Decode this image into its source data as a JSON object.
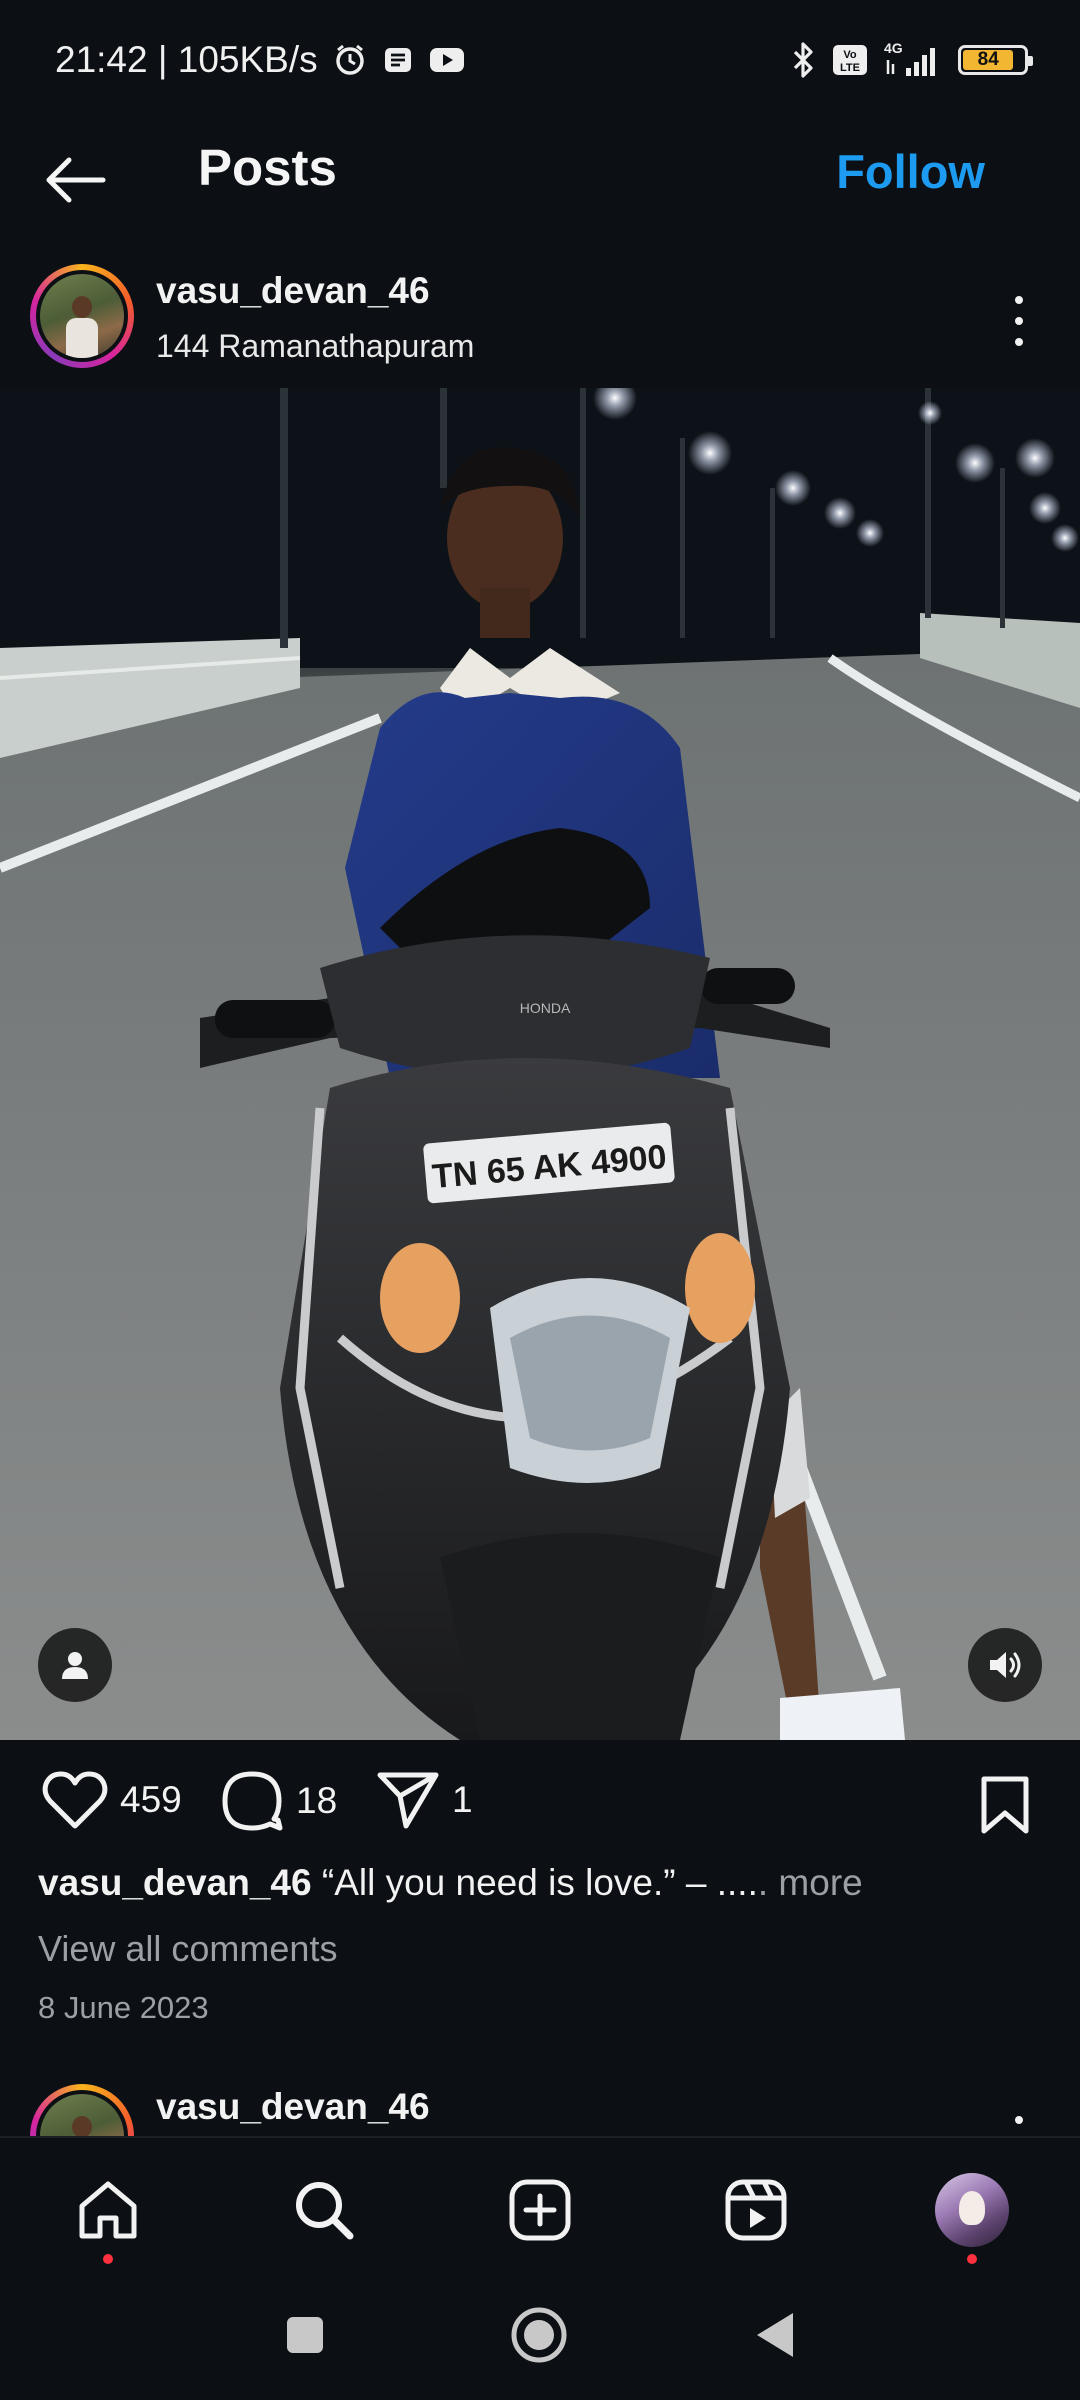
{
  "status_bar": {
    "time_speed": "21:42 | 105KB/s",
    "network": "4G",
    "volte": "Vo LTE",
    "battery": "84",
    "battery_level_percent": 84,
    "icons": [
      "alarm-icon",
      "notes-icon",
      "youtube-icon",
      "bluetooth-icon",
      "signal-icon"
    ]
  },
  "header": {
    "title": "Posts",
    "follow_label": "Follow",
    "back_icon": "arrow-left-icon"
  },
  "post": {
    "username": "vasu_devan_46",
    "location": "144 Ramanathapuram",
    "photo_plate": "TN 65 AK 4900",
    "photo_brand": "HONDA",
    "likes": "459",
    "comments": "18",
    "shares": "1",
    "caption_user": "vasu_devan_46",
    "caption_text": "“All you need is love.” – ....",
    "caption_more": ". more",
    "view_comments": "View all comments",
    "date": "8 June 2023"
  },
  "next_post": {
    "username": "vasu_devan_46"
  },
  "bottom_nav": {
    "items": [
      "home-icon",
      "search-icon",
      "create-icon",
      "reels-icon",
      "profile-avatar"
    ]
  },
  "colors": {
    "background": "#0c0f14",
    "accent": "#1d9bf0",
    "notification": "#ff3040",
    "battery": "#f2b632"
  }
}
